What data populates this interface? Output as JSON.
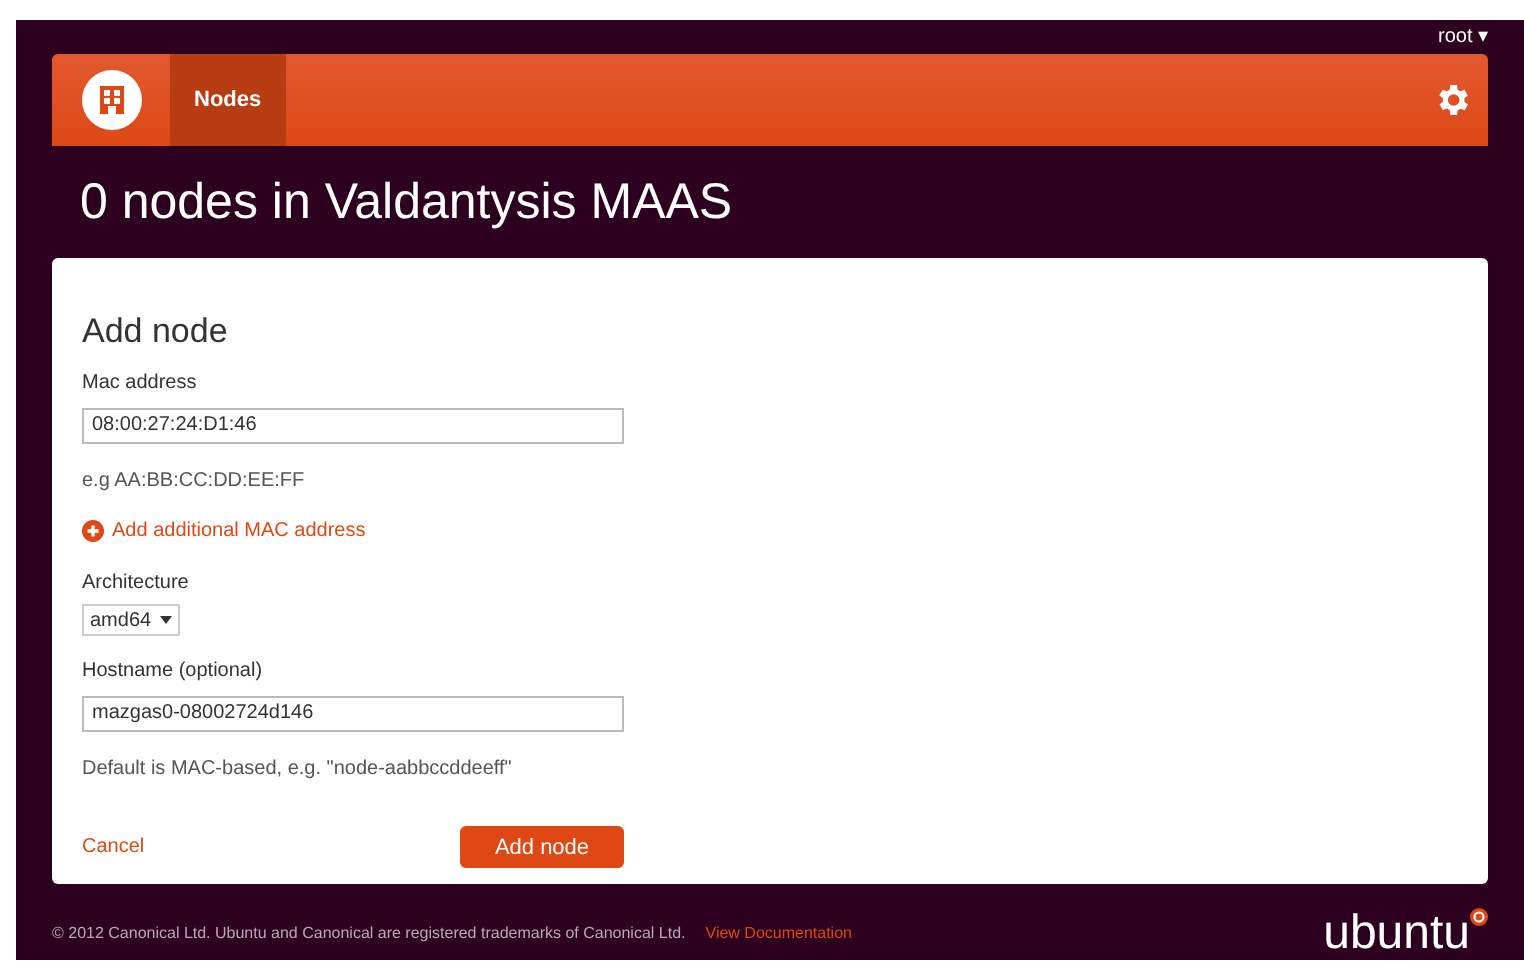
{
  "user_menu": {
    "label": "root ▾"
  },
  "nav": {
    "tabs": [
      {
        "label": "Nodes",
        "selected": true
      }
    ]
  },
  "page_title": "0 nodes in Valdantysis MAAS",
  "form": {
    "title": "Add node",
    "mac": {
      "label": "Mac address",
      "value": "08:00:27:24:D1:46",
      "hint": "e.g AA:BB:CC:DD:EE:FF"
    },
    "add_mac_link": "Add additional MAC address",
    "architecture": {
      "label": "Architecture",
      "value": "amd64"
    },
    "hostname": {
      "label": "Hostname (optional)",
      "value": "mazgas0-08002724d146",
      "hint": "Default is MAC-based, e.g. \"node-aabbccddeeff\""
    },
    "cancel": "Cancel",
    "submit": "Add node"
  },
  "footer": {
    "copyright": "© 2012 Canonical Ltd. Ubuntu and Canonical are registered trademarks of Canonical Ltd.",
    "link": "View Documentation",
    "logo": "ubuntu"
  }
}
